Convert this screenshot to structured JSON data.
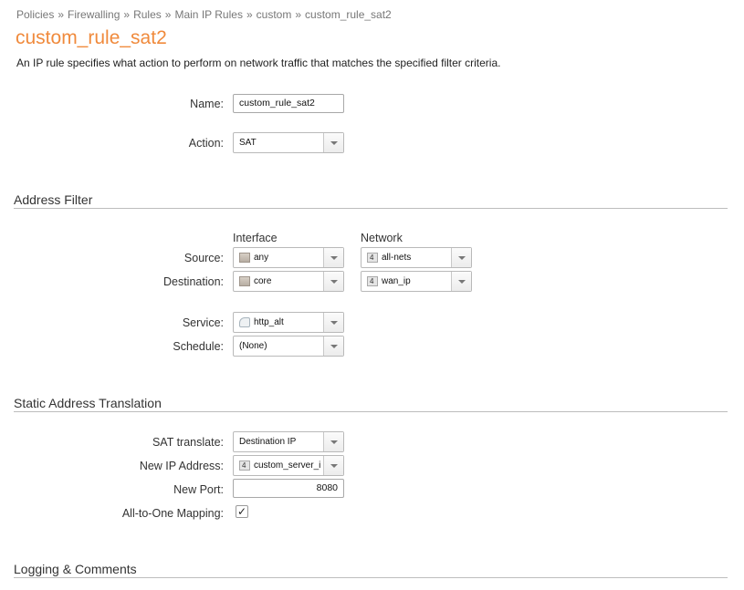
{
  "breadcrumb": [
    {
      "label": "Policies"
    },
    {
      "label": "Firewalling"
    },
    {
      "label": "Rules"
    },
    {
      "label": "Main IP Rules"
    },
    {
      "label": "custom"
    },
    {
      "label": "custom_rule_sat2"
    }
  ],
  "breadcrumb_separator": "»",
  "page": {
    "title": "custom_rule_sat2",
    "description": "An IP rule specifies what action to perform on network traffic that matches the specified filter criteria."
  },
  "general": {
    "name_label": "Name:",
    "name_value": "custom_rule_sat2",
    "action_label": "Action:",
    "action_value": "SAT"
  },
  "address_filter": {
    "heading": "Address Filter",
    "interface_header": "Interface",
    "network_header": "Network",
    "source_label": "Source:",
    "source_interface": "any",
    "source_network": "all-nets",
    "destination_label": "Destination:",
    "destination_interface": "core",
    "destination_network": "wan_ip",
    "service_label": "Service:",
    "service_value": "http_alt",
    "schedule_label": "Schedule:",
    "schedule_value": "(None)",
    "network_icon_glyph": "4"
  },
  "sat": {
    "heading": "Static Address Translation",
    "translate_label": "SAT translate:",
    "translate_value": "Destination IP",
    "new_ip_label": "New IP Address:",
    "new_ip_value": "custom_server_ip",
    "new_port_label": "New Port:",
    "new_port_value": "8080",
    "all_to_one_label": "All-to-One Mapping:",
    "all_to_one_checked": true,
    "check_glyph": "✓"
  },
  "logging": {
    "heading": "Logging & Comments"
  },
  "colors": {
    "title": "#f08a3c",
    "breadcrumb": "#777777",
    "section_rule": "#bdbdbd"
  },
  "icons": [
    "interface-icon",
    "network-object-icon",
    "service-icon",
    "dropdown-arrow-icon",
    "checkmark-icon"
  ]
}
